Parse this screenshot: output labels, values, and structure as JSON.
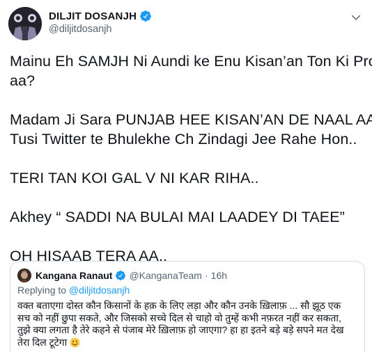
{
  "tweet": {
    "author": {
      "display_name": "DILJIT DOSANJH",
      "handle": "@diljitdosanjh",
      "verified_icon": "verified-badge-icon"
    },
    "menu_icon": "chevron-down-icon",
    "lines": [
      "Mainu Eh SAMJH Ni Aundi ke Enu Kisan’an Ton Ki Prob.",
      "aa?",
      "",
      "Madam Ji Sara PUNJAB HEE KISAN’AN DE NAAL AA..",
      "Tusi Twitter te Bhulekhe Ch Zindagi Jee Rahe Hon..",
      "",
      "TERI TAN KOI GAL V NI KAR RIHA..",
      "",
      "Akhey “ SADDI NA BULAI MAI LAADEY DI TAEE”",
      "",
      "OH HISAAB TERA AA.."
    ]
  },
  "quoted_tweet": {
    "author": {
      "display_name": "Kangana Ranaut",
      "handle": "@KanganaTeam",
      "separator": "·",
      "time": "16h"
    },
    "replying_prefix": "Replying to",
    "replying_to": "@diljitdosanjh",
    "lines": [
      "वक्त बताएगा दोस्त कौन किसानों के हक़ के लिए लड़ा और कौन उनके ख़िलाफ़ ... सौ झूठ एक",
      "सच को नहीं छुपा सकते, और जिसको सच्चे दिल से चाहो वो तुम्हें कभी नफ़रत नहीं कर सकता,",
      "तुझे क्या लगता है तेरे कहने से पंजाब मेरे ख़िलाफ़ हो जाएगा? हा हा इतने बड़े बड़े सपने मत देख",
      "तेरा दिल टूटेगा"
    ],
    "emoji_icon": "smiling-face-emoji-icon"
  },
  "colors": {
    "text": "#0f1419",
    "secondary": "#536471",
    "link": "#1d9bf0",
    "verified": "#1d9bf0",
    "border": "#cfd9de"
  }
}
